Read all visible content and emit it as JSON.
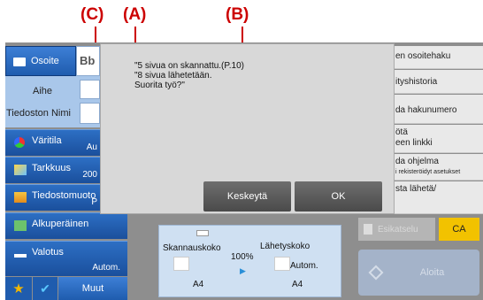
{
  "callouts": {
    "c": "(C)",
    "a": "(A)",
    "b": "(B)"
  },
  "sidebar": {
    "osoite": "Osoite",
    "osoite_extra": "Bb",
    "aihe": "Aihe",
    "tiedoston_nimi": "Tiedoston Nimi",
    "items": [
      {
        "label": "Väritila",
        "value": "Au"
      },
      {
        "label": "Tarkkuus",
        "value": "200"
      },
      {
        "label": "Tiedostomuoto",
        "value": "P"
      },
      {
        "label": "Alkuperäinen",
        "value": ""
      },
      {
        "label": "Valotus",
        "value": "Autom."
      }
    ],
    "muut": "Muut"
  },
  "right_column": [
    {
      "line1": "en osoitehaku",
      "line2": ""
    },
    {
      "line1": "ityshistoria",
      "line2": ""
    },
    {
      "line1": "da hakunumero",
      "line2": ""
    },
    {
      "line1": "ötä",
      "line2": "een linkki"
    },
    {
      "line1": "da ohjelma",
      "line2": "i rekisteröidyt asetukset"
    },
    {
      "line1": "sta lähetä/",
      "line2": ""
    }
  ],
  "dialog": {
    "message_lines": [
      "\"5 sivua on skannattu.(P.10)",
      "\"8 sivua lähetetään.",
      "Suorita työ?\""
    ],
    "cancel_label": "Keskeytä",
    "ok_label": "OK"
  },
  "scan_info": {
    "skannauskoko_label": "Skannauskoko",
    "lahetyskoko_label": "Lähetyskoko",
    "ratio": "100%",
    "scan_size": "A4",
    "send_size": "A4",
    "send_mode": "Autom."
  },
  "bottom_right": {
    "esikatselu": "Esikatselu",
    "ca": "CA",
    "aloita": "Aloita"
  },
  "colors": {
    "accent_red": "#cc0000",
    "blue": "#1f5cae",
    "ca_yellow": "#f2c200"
  }
}
